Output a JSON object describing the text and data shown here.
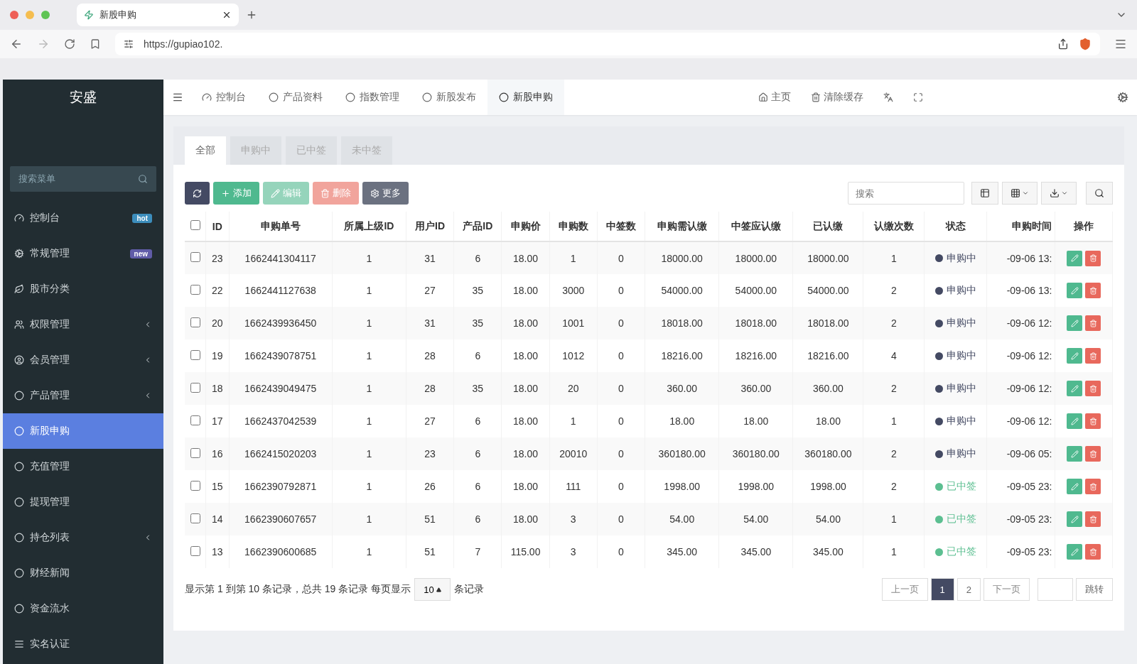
{
  "browser": {
    "tab_title": "新股申购",
    "url": "https://gupiao102."
  },
  "sidebar": {
    "brand": "安盛",
    "search": {
      "placeholder": "搜索菜单"
    },
    "items": [
      {
        "kind": "gauge",
        "label": "控制台",
        "badge": {
          "text": "hot",
          "color": "#3c8dbc"
        },
        "expandable": false,
        "selected": false
      },
      {
        "kind": "gears",
        "label": "常规管理",
        "badge": {
          "text": "new",
          "color": "#605ca8"
        },
        "expandable": false,
        "selected": false
      },
      {
        "kind": "leaf",
        "label": "股市分类",
        "expandable": false,
        "selected": false
      },
      {
        "kind": "users",
        "label": "权限管理",
        "expandable": true,
        "selected": false
      },
      {
        "kind": "user",
        "label": "会员管理",
        "expandable": true,
        "selected": false
      },
      {
        "kind": "circle",
        "label": "产品管理",
        "expandable": true,
        "selected": false
      },
      {
        "kind": "circle",
        "label": "新股申购",
        "expandable": false,
        "selected": true
      },
      {
        "kind": "circle",
        "label": "充值管理",
        "expandable": false,
        "selected": false
      },
      {
        "kind": "circle",
        "label": "提现管理",
        "expandable": false,
        "selected": false
      },
      {
        "kind": "circle",
        "label": "持仓列表",
        "expandable": true,
        "selected": false
      },
      {
        "kind": "circle",
        "label": "财经新闻",
        "expandable": false,
        "selected": false
      },
      {
        "kind": "circle",
        "label": "资金流水",
        "expandable": false,
        "selected": false
      },
      {
        "kind": "list",
        "label": "实名认证",
        "expandable": false,
        "selected": false
      }
    ]
  },
  "top_nav": {
    "tabs": [
      {
        "kind": "gauge",
        "label": "控制台",
        "selected": false
      },
      {
        "kind": "circle",
        "label": "产品资料",
        "selected": false
      },
      {
        "kind": "circle",
        "label": "指数管理",
        "selected": false
      },
      {
        "kind": "circle",
        "label": "新股发布",
        "selected": false
      },
      {
        "kind": "circle",
        "label": "新股申购",
        "selected": true
      }
    ],
    "actions": [
      {
        "kind": "home",
        "label": "主页"
      },
      {
        "kind": "trash",
        "label": "清除缓存"
      },
      {
        "kind": "translate"
      },
      {
        "kind": "fullscreen"
      }
    ]
  },
  "filter_tabs": [
    {
      "label": "全部",
      "selected": true
    },
    {
      "label": "申购中",
      "selected": false
    },
    {
      "label": "已中签",
      "selected": false
    },
    {
      "label": "未中签",
      "selected": false
    }
  ],
  "toolbar": {
    "buttons": [
      {
        "kind": "refresh",
        "disabled": false
      },
      {
        "kind": "add",
        "label": "添加",
        "disabled": false
      },
      {
        "kind": "edit",
        "label": "编辑",
        "disabled": true
      },
      {
        "kind": "delete",
        "label": "删除",
        "disabled": true
      },
      {
        "kind": "more",
        "label": "更多",
        "disabled": false
      }
    ],
    "search": {
      "placeholder": "搜索"
    }
  },
  "table": {
    "select_all_checked": false,
    "columns": [
      "ID",
      "申购单号",
      "所属上级ID",
      "用户ID",
      "产品ID",
      "申购价",
      "申购数",
      "中签数",
      "申购需认缴",
      "中签应认缴",
      "已认缴",
      "认缴次数",
      "状态",
      "申购时间",
      "操作"
    ],
    "rows": [
      {
        "checked": false,
        "cells": [
          "23",
          "1662441304117",
          "1",
          "31",
          "6",
          "18.00",
          "1",
          "0",
          "18000.00",
          "18000.00",
          "18000.00",
          "1"
        ],
        "status": {
          "text": "申购中",
          "color": "#444a63"
        },
        "time": "-09-06 13:"
      },
      {
        "checked": false,
        "cells": [
          "22",
          "1662441127638",
          "1",
          "27",
          "35",
          "18.00",
          "3000",
          "0",
          "54000.00",
          "54000.00",
          "54000.00",
          "2"
        ],
        "status": {
          "text": "申购中",
          "color": "#444a63"
        },
        "time": "-09-06 13:"
      },
      {
        "checked": false,
        "cells": [
          "20",
          "1662439936450",
          "1",
          "31",
          "35",
          "18.00",
          "1001",
          "0",
          "18018.00",
          "18018.00",
          "18018.00",
          "2"
        ],
        "status": {
          "text": "申购中",
          "color": "#444a63"
        },
        "time": "-09-06 12:"
      },
      {
        "checked": false,
        "cells": [
          "19",
          "1662439078751",
          "1",
          "28",
          "6",
          "18.00",
          "1012",
          "0",
          "18216.00",
          "18216.00",
          "18216.00",
          "4"
        ],
        "status": {
          "text": "申购中",
          "color": "#444a63"
        },
        "time": "-09-06 12:"
      },
      {
        "checked": false,
        "cells": [
          "18",
          "1662439049475",
          "1",
          "28",
          "35",
          "18.00",
          "20",
          "0",
          "360.00",
          "360.00",
          "360.00",
          "2"
        ],
        "status": {
          "text": "申购中",
          "color": "#444a63"
        },
        "time": "-09-06 12:"
      },
      {
        "checked": false,
        "cells": [
          "17",
          "1662437042539",
          "1",
          "27",
          "6",
          "18.00",
          "1",
          "0",
          "18.00",
          "18.00",
          "18.00",
          "1"
        ],
        "status": {
          "text": "申购中",
          "color": "#444a63"
        },
        "time": "-09-06 12:"
      },
      {
        "checked": false,
        "cells": [
          "16",
          "1662415020203",
          "1",
          "23",
          "6",
          "18.00",
          "20010",
          "0",
          "360180.00",
          "360180.00",
          "360180.00",
          "2"
        ],
        "status": {
          "text": "申购中",
          "color": "#444a63"
        },
        "time": "-09-06 05:"
      },
      {
        "checked": false,
        "cells": [
          "15",
          "1662390792871",
          "1",
          "26",
          "6",
          "18.00",
          "111",
          "0",
          "1998.00",
          "1998.00",
          "1998.00",
          "2"
        ],
        "status": {
          "text": "已中签",
          "color": "#5cbf91"
        },
        "time": "-09-05 23:"
      },
      {
        "checked": false,
        "cells": [
          "14",
          "1662390607657",
          "1",
          "51",
          "6",
          "18.00",
          "3",
          "0",
          "54.00",
          "54.00",
          "54.00",
          "1"
        ],
        "status": {
          "text": "已中签",
          "color": "#5cbf91"
        },
        "time": "-09-05 23:"
      },
      {
        "checked": false,
        "cells": [
          "13",
          "1662390600685",
          "1",
          "51",
          "7",
          "115.00",
          "3",
          "0",
          "345.00",
          "345.00",
          "345.00",
          "1"
        ],
        "status": {
          "text": "已中签",
          "color": "#5cbf91"
        },
        "time": "-09-05 23:"
      }
    ]
  },
  "pagination": {
    "summary": "显示第 1 到第 10 条记录，总共 19 条记录 每页显示",
    "page_size": "10",
    "suffix": "条记录",
    "pages": [
      {
        "label": "上一页",
        "kind": "nav",
        "selected": false
      },
      {
        "label": "1",
        "kind": "page",
        "selected": true
      },
      {
        "label": "2",
        "kind": "page",
        "selected": false
      },
      {
        "label": "下一页",
        "kind": "nav",
        "selected": false
      }
    ],
    "jump": "跳转"
  }
}
